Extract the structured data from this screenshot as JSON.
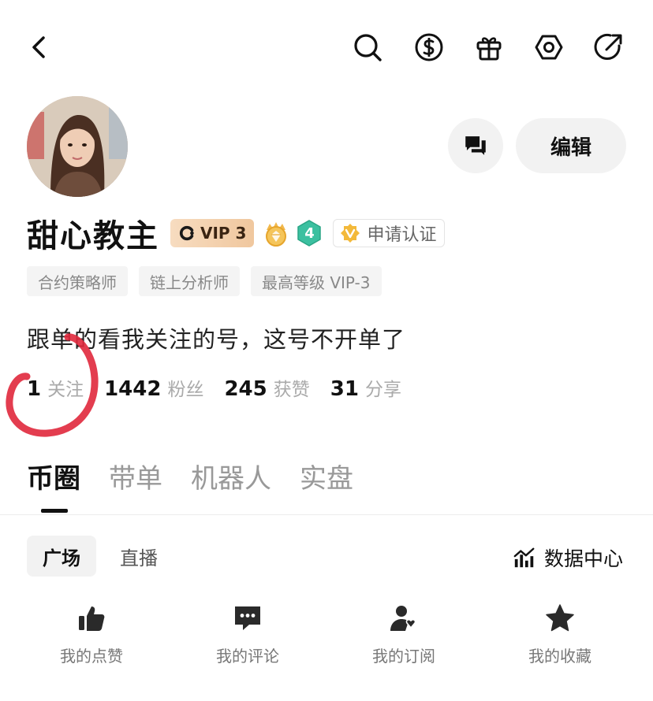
{
  "profile": {
    "name": "甜心教主",
    "vip_label": "VIP 3",
    "level": "4",
    "cert_label": "申请认证",
    "edit_label": "编辑",
    "tags": [
      "合约策略师",
      "链上分析师",
      "最高等级 VIP-3"
    ],
    "bio": "跟单的看我关注的号，这号不开单了"
  },
  "stats": [
    {
      "value": "1",
      "label": "关注"
    },
    {
      "value": "1442",
      "label": "粉丝"
    },
    {
      "value": "245",
      "label": "获赞"
    },
    {
      "value": "31",
      "label": "分享"
    }
  ],
  "tabs": [
    "币圈",
    "带单",
    "机器人",
    "实盘"
  ],
  "subtabs": [
    "广场",
    "直播"
  ],
  "data_center_label": "数据中心",
  "actions": [
    {
      "label": "我的点赞",
      "icon": "thumbs-up-icon"
    },
    {
      "label": "我的评论",
      "icon": "comment-icon"
    },
    {
      "label": "我的订阅",
      "icon": "subscription-icon"
    },
    {
      "label": "我的收藏",
      "icon": "star-icon"
    }
  ],
  "colors": {
    "vip_gold": "#f0c79e",
    "level_teal": "#3cc0a0",
    "annotation_red": "#e0283c"
  }
}
